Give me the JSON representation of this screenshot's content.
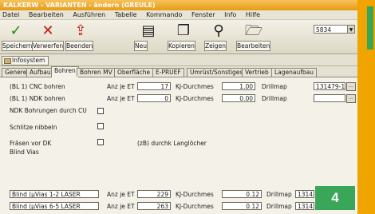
{
  "window": {
    "title": "KALKERW - VARIANTEN - ändern (GREULE)"
  },
  "menu": [
    "Datei",
    "Bearbeiten",
    "Ausführen",
    "Tabelle",
    "Kommando",
    "Fenster",
    "Info",
    "Hilfe"
  ],
  "toolbar": {
    "buttons": [
      {
        "label": "Speichern",
        "icon": "check-icon",
        "glyph": "✓",
        "color": "#1a8f1a"
      },
      {
        "label": "Verwerfen",
        "icon": "cross-icon",
        "glyph": "✕",
        "color": "#c41616"
      },
      {
        "label": "Beenden",
        "icon": "exit-icon",
        "glyph": "⇪",
        "color": "#c41616"
      },
      {
        "label": "Neu",
        "icon": "new-doc-icon",
        "glyph": "▤",
        "color": "#3a3a3a"
      },
      {
        "label": "Kopieren",
        "icon": "copy-icon",
        "glyph": "❐",
        "color": "#3a3a3a"
      },
      {
        "label": "Zeigen",
        "icon": "magnifier-icon",
        "glyph": "⚲",
        "color": "#3a3a3a"
      },
      {
        "label": "Bearbeiten",
        "icon": "folder-edit-icon",
        "glyph": "🗁",
        "color": "#3a3a3a"
      }
    ],
    "combo_value": "5834"
  },
  "infosystem_label": "Infosystem",
  "tabs": [
    "Generell",
    "Aufbau",
    "Bohren",
    "Bohren MV",
    "Oberfläche",
    "E-PRUEF",
    "Umrüst/Sonstiges",
    "Vertrieb",
    "Lagenaufbau"
  ],
  "active_tab": "Bohren",
  "rows": [
    {
      "label": "(BL 1) CNC bohren",
      "anz_label": "Anz je ET",
      "anz_value": "17",
      "kj_label": "KJ-Durchmes",
      "kj_value": "1.00",
      "drill_label": "Drillmap",
      "drill_value": "131479-1"
    },
    {
      "label": "(BL 1) NDK bohren",
      "anz_label": "Anz je ET",
      "anz_value": "0",
      "kj_label": "KJ-Durchmes",
      "kj_value": "0.00",
      "drill_label": "Drillmap",
      "drill_value": ""
    }
  ],
  "ndk_label": "NDK Bohrungen durch CU",
  "schlitze_label": "Schlitze nibbeln",
  "fraesen_label": "Fräsen vor DK",
  "fraesen_note": "(zB) durchk Langlöcher",
  "blind_title": "Blind Vias",
  "blind_rows": [
    {
      "name": "Blind (µVias 1-2 LASER",
      "anz_label": "Anz je ET",
      "anz_value": "229",
      "kj_label": "KJ-Durchmes",
      "kj_value": "0.12",
      "drill_label": "Drillmap",
      "drill_value": "1314"
    },
    {
      "name": "Blind (µVias 6-5 LASER",
      "anz_label": "Anz je ET",
      "anz_value": "263",
      "kj_label": "KJ-Durchmes",
      "kj_value": "0.12",
      "drill_label": "Drillmap",
      "drill_value": "1314"
    }
  ],
  "badge": "4",
  "colors": {
    "accent": "#f0a400",
    "badge": "#3aa65a",
    "title_bar": "#e79b14"
  }
}
